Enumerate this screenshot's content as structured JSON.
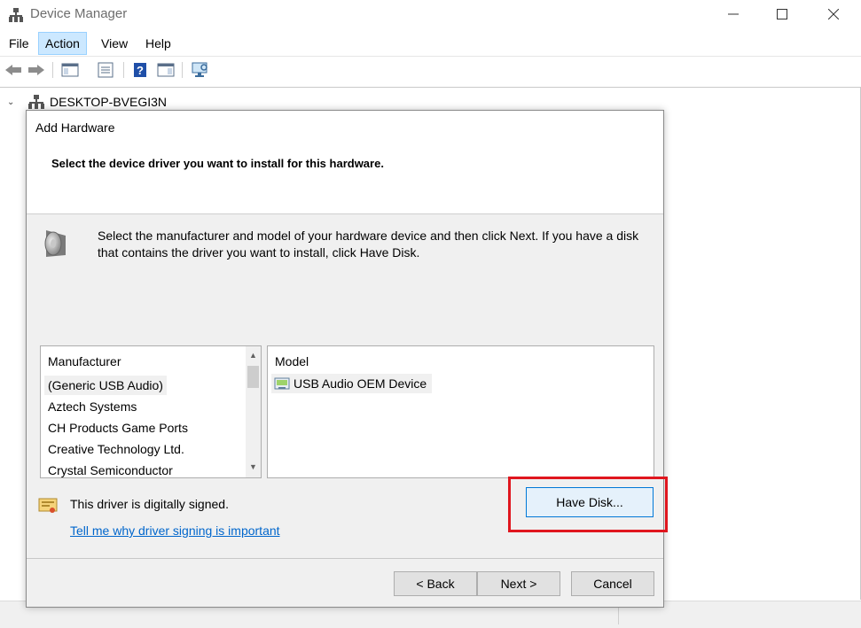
{
  "window": {
    "title": "Device Manager"
  },
  "menu": {
    "items": [
      "File",
      "Action",
      "View",
      "Help"
    ],
    "active": "Action"
  },
  "tree": {
    "root_label": "DESKTOP-BVEGI3N"
  },
  "dialog": {
    "title": "Add Hardware",
    "heading": "Select the device driver you want to install for this hardware.",
    "description": "Select the manufacturer and model of your hardware device and then click Next. If you have a disk that contains the driver you want to install, click Have Disk.",
    "manufacturer_list": {
      "header": "Manufacturer",
      "items": [
        "(Generic USB Audio)",
        "Aztech Systems",
        "CH Products Game Ports",
        "Creative Technology Ltd.",
        "Crystal Semiconductor"
      ],
      "selected": "(Generic USB Audio)"
    },
    "model_list": {
      "header": "Model",
      "items": [
        "USB Audio OEM Device"
      ],
      "selected": "USB Audio OEM Device"
    },
    "signed_text": "This driver is digitally signed.",
    "signing_link": "Tell me why driver signing is important",
    "buttons": {
      "have_disk": "Have Disk...",
      "back": "< Back",
      "next": "Next >",
      "cancel": "Cancel"
    }
  },
  "colors": {
    "highlight_box": "#e0161e",
    "link": "#0066cc",
    "menu_active": "#cce8ff",
    "focus_border": "#0078d7"
  }
}
